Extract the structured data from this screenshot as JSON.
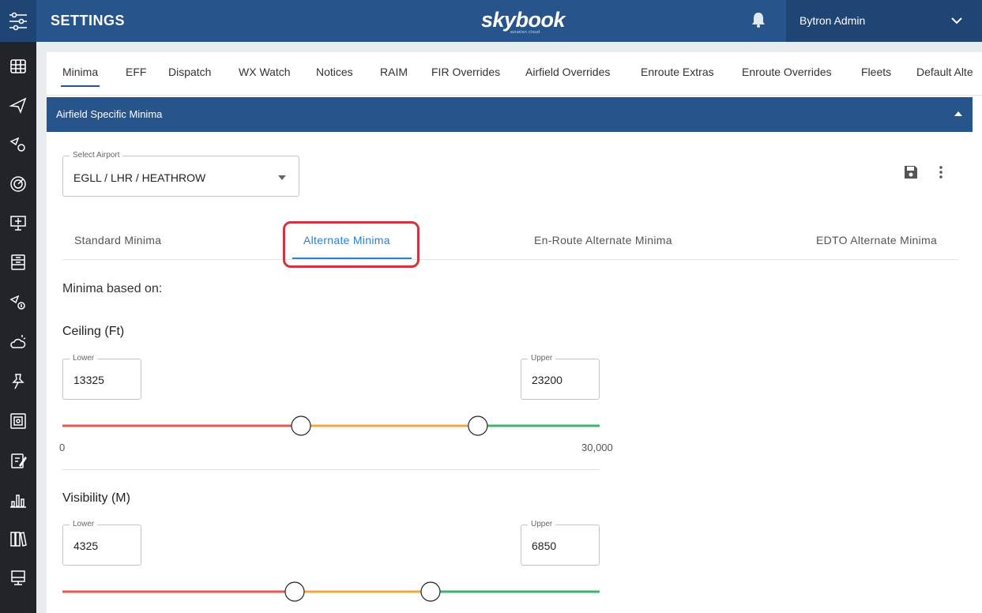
{
  "header": {
    "title": "SETTINGS",
    "logo": "skybook",
    "logo_sub": "aviation cloud",
    "user": "Bytron Admin"
  },
  "tabs": [
    "Minima",
    "EFF",
    "Dispatch",
    "WX Watch",
    "Notices",
    "RAIM",
    "FIR Overrides",
    "Airfield Overrides",
    "Enroute Extras",
    "Enroute Overrides",
    "Fleets",
    "Default Alte"
  ],
  "active_tab": "Minima",
  "panel": {
    "title": "Airfield Specific Minima",
    "select_label": "Select Airport",
    "select_value": "EGLL / LHR / HEATHROW"
  },
  "subtabs": [
    "Standard Minima",
    "Alternate Minima",
    "En-Route Alternate Minima",
    "EDTO Alternate Minima"
  ],
  "active_subtab": "Alternate Minima",
  "minima_based_on": "Minima based on:",
  "ceiling": {
    "title": "Ceiling (Ft)",
    "lower_label": "Lower",
    "lower": "13325",
    "upper_label": "Upper",
    "upper": "23200",
    "min": "0",
    "max": "30,000",
    "min_value": 0,
    "max_value": 30000,
    "lower_value": 13325,
    "upper_value": 23200
  },
  "visibility": {
    "title": "Visibility (M)",
    "lower_label": "Lower",
    "lower": "4325",
    "upper_label": "Upper",
    "upper": "6850"
  },
  "colors": {
    "header": "#27548a",
    "sidebar": "#212529",
    "range_low": "#e8574e",
    "range_mid": "#f2a93b",
    "range_high": "#3cb371",
    "accent": "#2d7fd0",
    "highlight": "#d03441"
  }
}
